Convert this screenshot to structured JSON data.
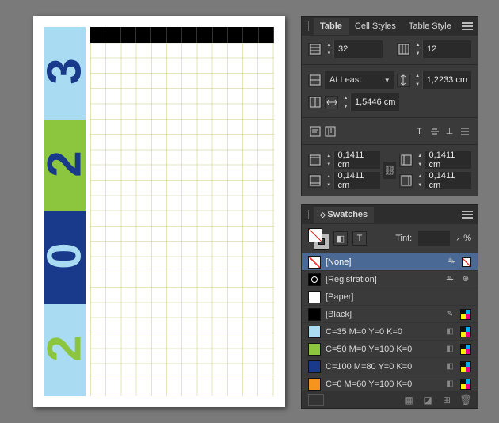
{
  "document": {
    "year_digits": [
      {
        "char": "2",
        "bg": "#a9dcf2",
        "fg": "#8cc63f"
      },
      {
        "char": "0",
        "bg": "#19398a",
        "fg": "#a9dcf2"
      },
      {
        "char": "2",
        "bg": "#8cc63f",
        "fg": "#19398a"
      },
      {
        "char": "3",
        "bg": "#a9dcf2",
        "fg": "#19398a"
      }
    ],
    "table_columns": 12
  },
  "table_panel": {
    "tabs": [
      "Table",
      "Cell Styles",
      "Table Style"
    ],
    "active_tab": 0,
    "rows": "32",
    "cols": "12",
    "row_height_mode": "At Least",
    "row_height": "1,2233 cm",
    "col_width": "1,5446 cm",
    "inset_top": "0,1411 cm",
    "inset_left": "0,1411 cm",
    "inset_bottom": "0,1411 cm",
    "inset_right": "0,1411 cm"
  },
  "swatches_panel": {
    "title": "Swatches",
    "tint_label": "Tint:",
    "tint_unit": "%",
    "items": [
      {
        "name": "[None]",
        "chip_class": "none",
        "icons": [
          "noedit",
          "none"
        ]
      },
      {
        "name": "[Registration]",
        "chip_class": "reg",
        "icons": [
          "noedit",
          "target"
        ]
      },
      {
        "name": "[Paper]",
        "chip_color": "#ffffff",
        "icons": []
      },
      {
        "name": "[Black]",
        "chip_color": "#000000",
        "icons": [
          "noedit",
          "cmyk"
        ]
      },
      {
        "name": "C=35 M=0 Y=0 K=0",
        "chip_color": "#a9dcf2",
        "icons": [
          "proc",
          "cmyk"
        ]
      },
      {
        "name": "C=50 M=0 Y=100 K=0",
        "chip_color": "#8cc63f",
        "icons": [
          "proc",
          "cmyk"
        ]
      },
      {
        "name": "C=100 M=80 Y=0 K=0",
        "chip_color": "#19398a",
        "icons": [
          "proc",
          "cmyk"
        ]
      },
      {
        "name": "C=0 M=60 Y=100 K=0",
        "chip_color": "#f7941e",
        "icons": [
          "proc",
          "cmyk"
        ]
      }
    ],
    "selected_index": 0
  }
}
